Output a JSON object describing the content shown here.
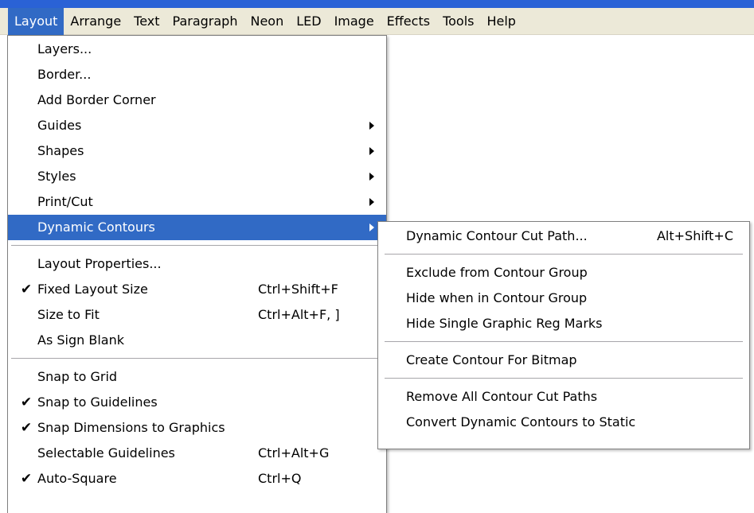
{
  "menubar": {
    "items": [
      {
        "label": "Layout"
      },
      {
        "label": "Arrange"
      },
      {
        "label": "Text"
      },
      {
        "label": "Paragraph"
      },
      {
        "label": "Neon"
      },
      {
        "label": "LED"
      },
      {
        "label": "Image"
      },
      {
        "label": "Effects"
      },
      {
        "label": "Tools"
      },
      {
        "label": "Help"
      }
    ],
    "active": "Layout"
  },
  "layout_menu": {
    "items": [
      {
        "label": "Layers..."
      },
      {
        "label": "Border..."
      },
      {
        "label": "Add Border Corner"
      },
      {
        "label": "Guides",
        "submenu": true
      },
      {
        "label": "Shapes",
        "submenu": true
      },
      {
        "label": "Styles",
        "submenu": true
      },
      {
        "label": "Print/Cut",
        "submenu": true
      },
      {
        "label": "Dynamic Contours",
        "submenu": true,
        "highlighted": true
      },
      {
        "label": "Layout Properties..."
      },
      {
        "label": "Fixed Layout Size",
        "checked": true,
        "shortcut": "Ctrl+Shift+F"
      },
      {
        "label": "Size to Fit",
        "shortcut": "Ctrl+Alt+F, ]"
      },
      {
        "label": "As Sign Blank"
      },
      {
        "label": "Snap to Grid"
      },
      {
        "label": "Snap to Guidelines",
        "checked": true
      },
      {
        "label": "Snap Dimensions to Graphics",
        "checked": true
      },
      {
        "label": "Selectable Guidelines",
        "shortcut": "Ctrl+Alt+G"
      },
      {
        "label": "Auto-Square",
        "checked": true,
        "shortcut": "Ctrl+Q"
      }
    ]
  },
  "contours_submenu": {
    "items": [
      {
        "label": "Dynamic Contour Cut Path...",
        "shortcut": "Alt+Shift+C"
      },
      {
        "label": "Exclude from Contour Group"
      },
      {
        "label": "Hide when in Contour Group"
      },
      {
        "label": "Hide Single Graphic Reg Marks"
      },
      {
        "label": "Create Contour For Bitmap"
      },
      {
        "label": "Remove All Contour Cut Paths"
      },
      {
        "label": "Convert Dynamic Contours to Static"
      }
    ]
  },
  "check_glyph": "✔",
  "colors": {
    "highlight": "#316ac5",
    "menubar_bg": "#ece9d8",
    "title_strip": "#2a62d6"
  }
}
